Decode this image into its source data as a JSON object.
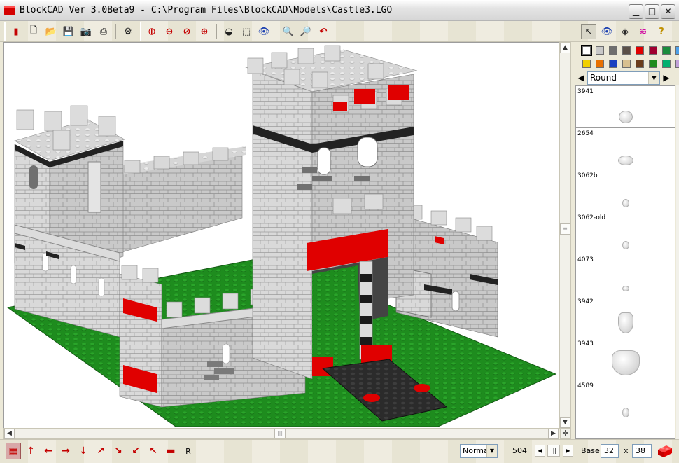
{
  "window": {
    "title": "BlockCAD Ver 3.0Beta9 - C:\\Program Files\\BlockCAD\\Models\\Castle3.LGO",
    "minimize": "▁",
    "maximize": "□",
    "close": "✕"
  },
  "colors": {
    "brick_red": "#e00000",
    "baseplate_green": "#1e8c1e",
    "stone_gray": "#c8c8c8",
    "dark_gray": "#6e6e6e",
    "black": "#1e1e1e"
  },
  "palette": [
    "#ffffff",
    "#c8c8c8",
    "#6e6e6e",
    "#5a5048",
    "#e00000",
    "#a00030",
    "#1a8c3c",
    "#4da0e8",
    "#f0d000",
    "#e87000",
    "#1a40c0",
    "#d8c090",
    "#6a3c1c",
    "#1e8c1e",
    "#00b070",
    "#c0a0d8"
  ],
  "shape_selector": {
    "value": "Round",
    "prev": "◀",
    "next": "▶"
  },
  "parts": [
    {
      "id": "3941"
    },
    {
      "id": "2654"
    },
    {
      "id": "3062b"
    },
    {
      "id": "3062-old"
    },
    {
      "id": "4073"
    },
    {
      "id": "3942"
    },
    {
      "id": "3943"
    },
    {
      "id": "4589"
    }
  ],
  "status": {
    "mode": "Norma",
    "count": "504",
    "base_label": "Base:",
    "base_x": "32",
    "times": "x",
    "base_y": "38",
    "rotate_label": "R"
  },
  "icons": {
    "toolbar": [
      "open-brick-icon",
      "new-file-icon",
      "open-folder-icon",
      "save-icon",
      "camera-icon",
      "print-icon",
      "settings-icon",
      "rotate-y-icon",
      "rotate-x-icon",
      "rotate-z-icon",
      "rotate-all-icon",
      "shade-icon",
      "wireframe-icon",
      "eye-icon",
      "zoom-in-icon",
      "zoom-out-icon",
      "undo-icon"
    ],
    "panel": [
      "pointer-icon",
      "eye-icon",
      "brick-view-icon",
      "rainbow-icon",
      "help-icon"
    ]
  }
}
